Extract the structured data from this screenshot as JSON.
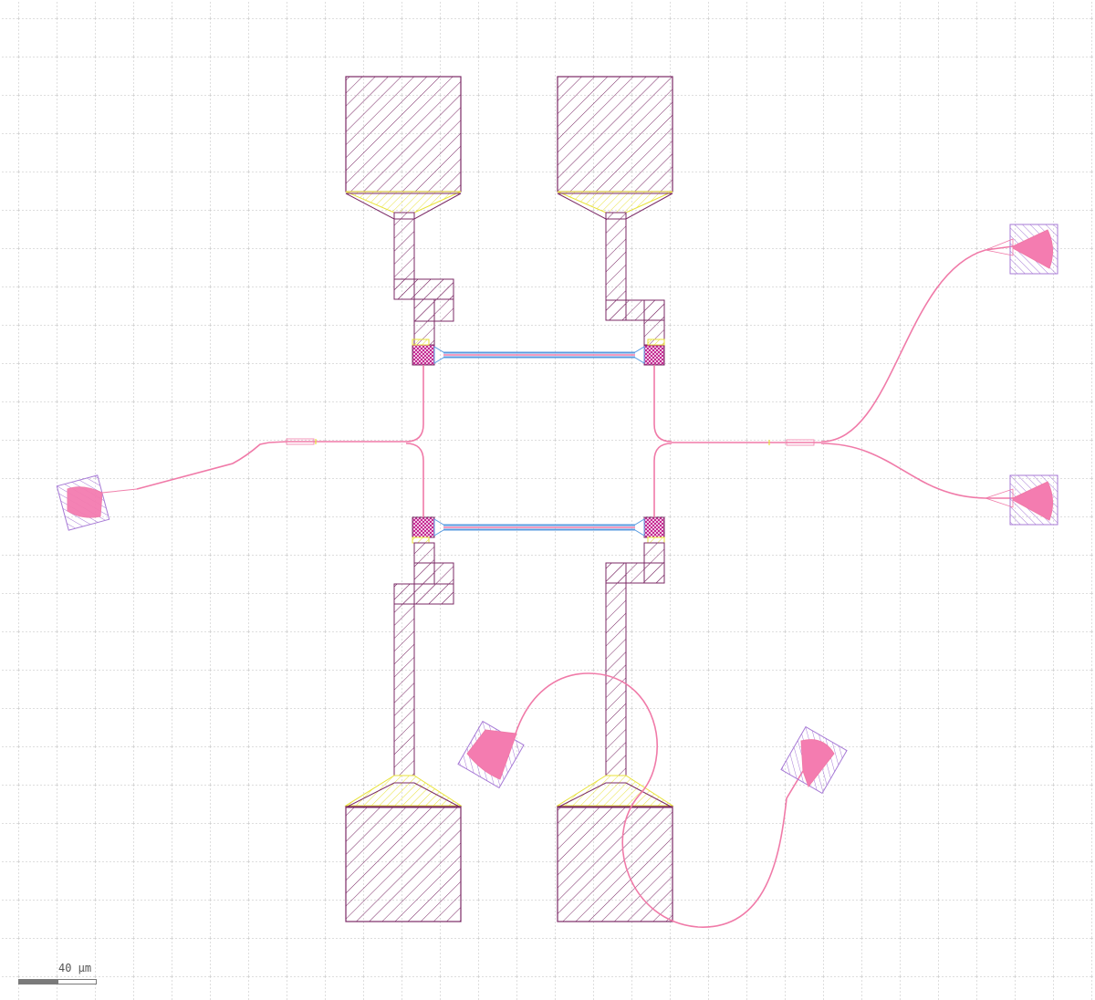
{
  "canvas": {
    "background": "#ffffff",
    "grid_color": "#b9b9b9"
  },
  "layers": {
    "metal": "#7b2a66",
    "taper": "#f2ee3a",
    "waveguide": "#f07aa8",
    "grating_fill": "#f47cb0",
    "grating_box": "#a77ad6",
    "via": "#c0188a",
    "heater_outline": "#5a9be0"
  },
  "scale_bar": {
    "label": "40 μm"
  },
  "icons": [
    "grating-coupler-icon",
    "bond-pad-icon",
    "via-icon"
  ]
}
